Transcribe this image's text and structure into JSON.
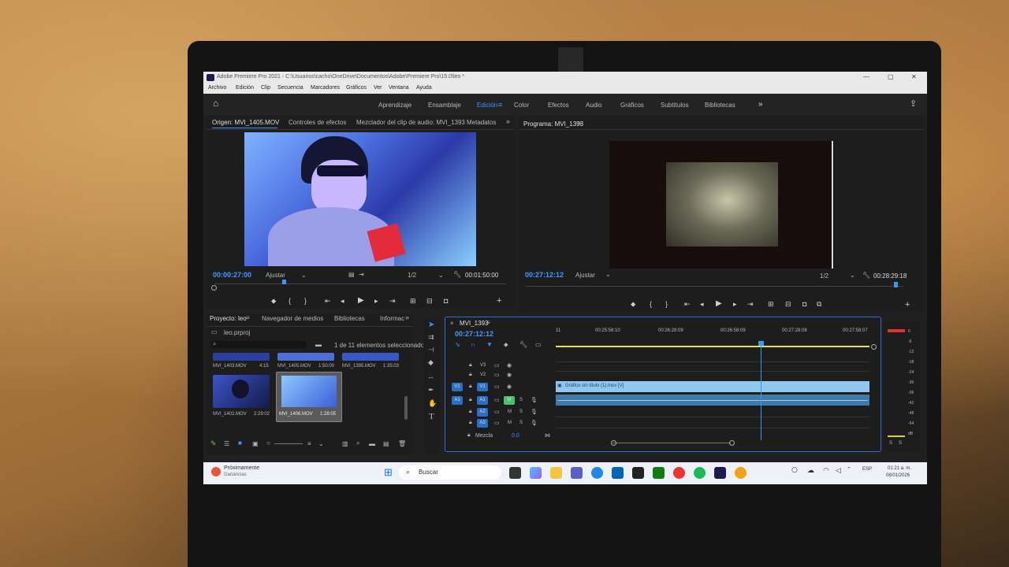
{
  "window": {
    "title": "Adobe Premiere Pro 2021 - C:\\Usuarios\\cacho\\OneDrive\\Documentos\\Adobe\\Premiere Pro\\15.0\\leo *",
    "min": "—",
    "max": "▢",
    "close": "✕"
  },
  "menu": [
    "Archivo",
    "Edición",
    "Clip",
    "Secuencia",
    "Marcadores",
    "Gráficos",
    "Ver",
    "Ventana",
    "Ayuda"
  ],
  "workspaces": [
    "Aprendizaje",
    "Ensamblaje",
    "Edición",
    "Color",
    "Efectos",
    "Audio",
    "Gráficos",
    "Subtítulos",
    "Bibliotecas"
  ],
  "workspace_active": "Edición",
  "workspace_more": "»",
  "source_panel": {
    "tabs": [
      "Origen: MVI_1405.MOV",
      "Controles de efectos",
      "Mezclador del clip de audio: MVI_1393",
      "Metadatos"
    ],
    "timecode": "00:00:27:00",
    "fit": "Ajustar",
    "resolution": "1/2",
    "duration": "00:01:50:00"
  },
  "program_panel": {
    "tab": "Programa: MVI_1393",
    "timecode": "00:27:12:12",
    "fit": "Ajustar",
    "resolution": "1/2",
    "duration": "00:28:29:18"
  },
  "project_panel": {
    "tabs": [
      "Proyecto: leo",
      "Navegador de medios",
      "Bibliotecas",
      "Informac"
    ],
    "project_file": "leo.prproj",
    "selection_info": "1 de 11 elementos seleccionados",
    "clips_top": [
      {
        "name": "MVI_1403.MOV",
        "duration": "4:15"
      },
      {
        "name": "MVI_1405.MOV",
        "duration": "1:50:00"
      },
      {
        "name": "MVI_1395.MOV",
        "duration": "1:35:03"
      }
    ],
    "clips_bottom": [
      {
        "name": "MVI_1402.MOV",
        "duration": "2:29:02"
      },
      {
        "name": "MVI_1406.MOV",
        "duration": "1:28:05"
      }
    ]
  },
  "timeline": {
    "tab": "MVI_1393",
    "timecode": "00:27:12:12",
    "ruler": [
      "11",
      "00:25:58:10",
      "00:26:28:09",
      "00:26:58:09",
      "00:27:28:08",
      "00:27:58:07"
    ],
    "tracks": [
      "V3",
      "V2",
      "V1",
      "A1",
      "A2",
      "A3"
    ],
    "source_patch": [
      "V1",
      "A1"
    ],
    "video_clip_label": "Gráfico sin título (1).mov [V]",
    "mix_label": "Mezcla",
    "mix_value": "0.0",
    "mute": "M",
    "solo": "S"
  },
  "meter": {
    "scale": [
      "0",
      "-6",
      "-12",
      "-18",
      "-24",
      "-30",
      "-36",
      "-42",
      "-48",
      "-54",
      "dB"
    ],
    "solo": [
      "S",
      "S"
    ]
  },
  "taskbar": {
    "weather_title": "Próximamente",
    "weather_sub": "Ganancias",
    "search": "Buscar",
    "time": "01:21 a. m.",
    "date": "08/01/2026",
    "lang": "ESP"
  }
}
